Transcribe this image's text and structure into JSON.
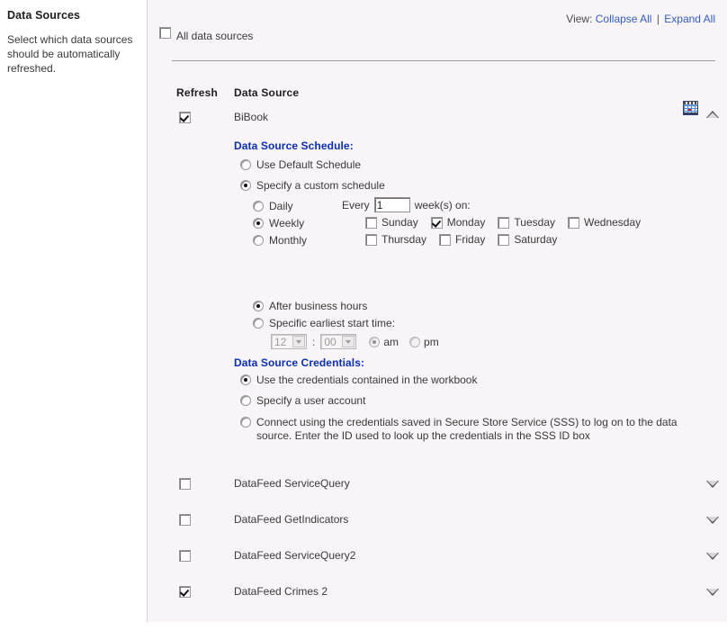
{
  "left_panel": {
    "title": "Data Sources",
    "description": "Select which data sources should be automatically refreshed."
  },
  "view": {
    "label": "View:",
    "collapse_all": "Collapse All",
    "separator": "|",
    "expand_all": "Expand All",
    "link_color": "#2f5ec4"
  },
  "all_data_sources": {
    "label": "All data sources",
    "checked": false
  },
  "columns": {
    "refresh": "Refresh",
    "data_source": "Data Source"
  },
  "expanded_source": {
    "name": "BiBook",
    "refresh_checked": true,
    "calendar_icon": "calendar-icon",
    "collapse_icon": "chevron-up-icon",
    "schedule": {
      "title": "Data Source Schedule:",
      "options": [
        {
          "label": "Use Default Schedule",
          "selected": false
        },
        {
          "label": "Specify a custom schedule",
          "selected": true
        }
      ],
      "frequency": [
        {
          "label": "Daily",
          "selected": false
        },
        {
          "label": "Weekly",
          "selected": true
        },
        {
          "label": "Monthly",
          "selected": false
        }
      ],
      "every_prefix": "Every",
      "every_value": "1",
      "every_suffix": "week(s) on:",
      "days": [
        {
          "label": "Sunday",
          "checked": false
        },
        {
          "label": "Monday",
          "checked": true
        },
        {
          "label": "Tuesday",
          "checked": false
        },
        {
          "label": "Wednesday",
          "checked": false
        },
        {
          "label": "Thursday",
          "checked": false
        },
        {
          "label": "Friday",
          "checked": false
        },
        {
          "label": "Saturday",
          "checked": false
        }
      ],
      "start_time_options": [
        {
          "label": "After business hours",
          "selected": true
        },
        {
          "label": "Specific earliest start time:",
          "selected": false
        }
      ],
      "time": {
        "hour": "12",
        "colon": ":",
        "minute": "00",
        "am_label": "am",
        "pm_label": "pm",
        "am_selected": true,
        "pm_selected": false,
        "disabled": true
      }
    },
    "credentials": {
      "title": "Data Source Credentials:",
      "options": [
        {
          "label": "Use the credentials contained in the workbook",
          "selected": true
        },
        {
          "label": "Specify a user account",
          "selected": false
        },
        {
          "label": "Connect using the credentials saved in Secure Store Service (SSS) to log on to the data source. Enter the ID used to look up the credentials in the SSS ID box",
          "selected": false
        }
      ]
    }
  },
  "collapsed_sources": [
    {
      "name": "DataFeed ServiceQuery",
      "refresh_checked": false,
      "expand_icon": "chevron-down-icon"
    },
    {
      "name": "DataFeed GetIndicators",
      "refresh_checked": false,
      "expand_icon": "chevron-down-icon"
    },
    {
      "name": "DataFeed ServiceQuery2",
      "refresh_checked": false,
      "expand_icon": "chevron-down-icon"
    },
    {
      "name": "DataFeed Crimes 2",
      "refresh_checked": true,
      "expand_icon": "chevron-down-icon"
    }
  ]
}
